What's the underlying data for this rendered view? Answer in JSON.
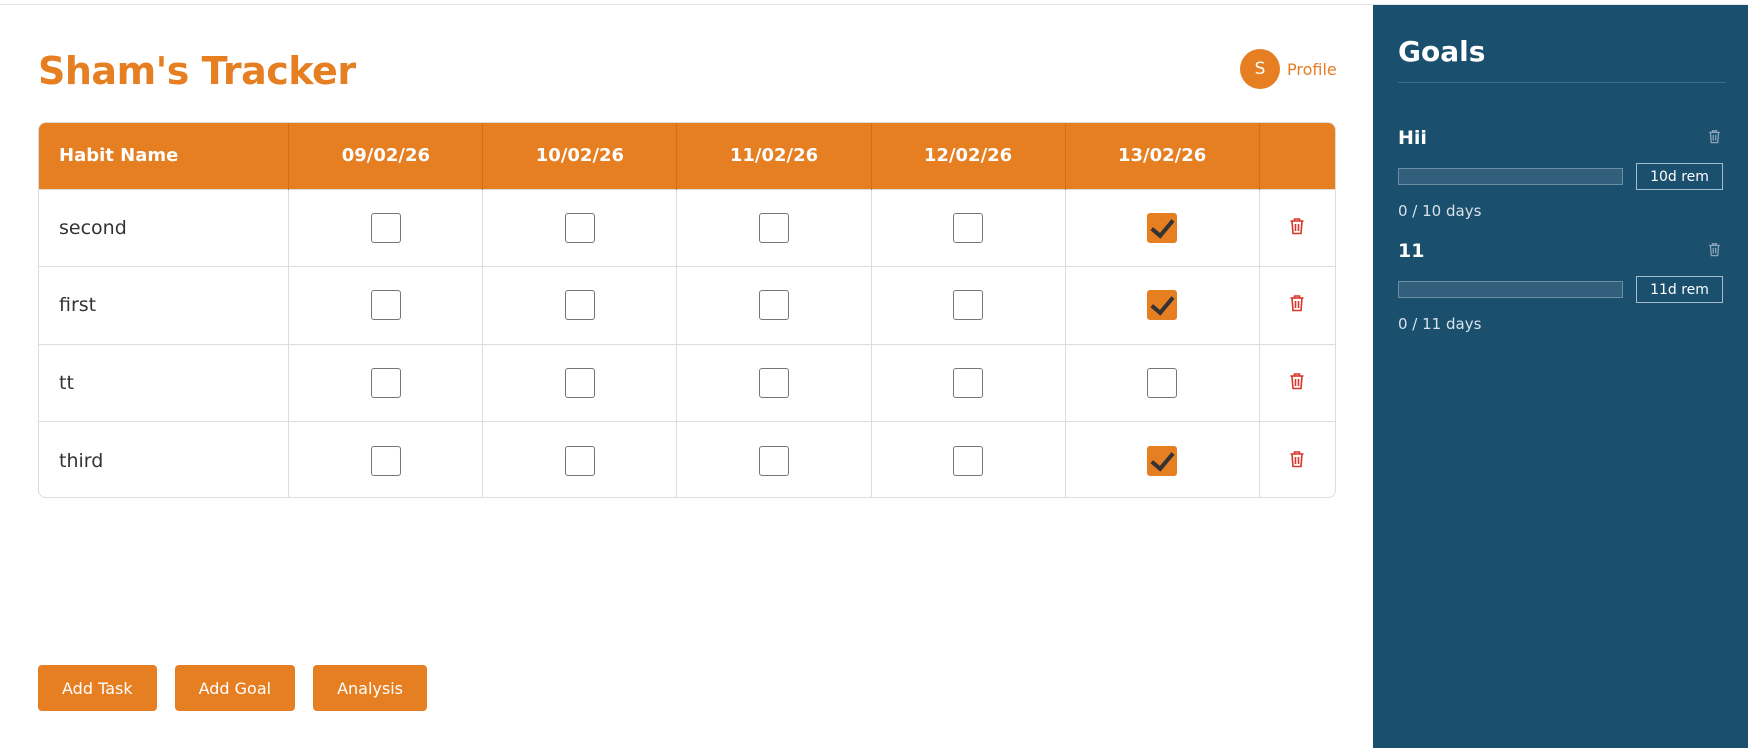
{
  "header": {
    "title": "Sham's Tracker",
    "avatar_initial": "S",
    "profile_label": "Profile"
  },
  "table": {
    "habit_header": "Habit Name",
    "dates": [
      "09/02/26",
      "10/02/26",
      "11/02/26",
      "12/02/26",
      "13/02/26"
    ],
    "habits": [
      {
        "name": "second",
        "checks": [
          false,
          false,
          false,
          false,
          true
        ]
      },
      {
        "name": "first",
        "checks": [
          false,
          false,
          false,
          false,
          true
        ]
      },
      {
        "name": "tt",
        "checks": [
          false,
          false,
          false,
          false,
          false
        ]
      },
      {
        "name": "third",
        "checks": [
          false,
          false,
          false,
          false,
          true
        ]
      }
    ]
  },
  "actions": {
    "add_task": "Add Task",
    "add_goal": "Add Goal",
    "analysis": "Analysis"
  },
  "sidebar": {
    "title": "Goals",
    "goals": [
      {
        "name": "Hii",
        "remaining": "10d rem",
        "progress_text": "0 / 10 days",
        "progress_fraction": 0
      },
      {
        "name": "11",
        "remaining": "11d rem",
        "progress_text": "0 / 11 days",
        "progress_fraction": 0
      }
    ]
  },
  "colors": {
    "accent": "#e67e22",
    "sidebar_bg": "#1b4f6e",
    "delete_red": "#d9362b"
  },
  "icons": {
    "delete": "trash-icon",
    "checked": "checkmark-icon"
  }
}
